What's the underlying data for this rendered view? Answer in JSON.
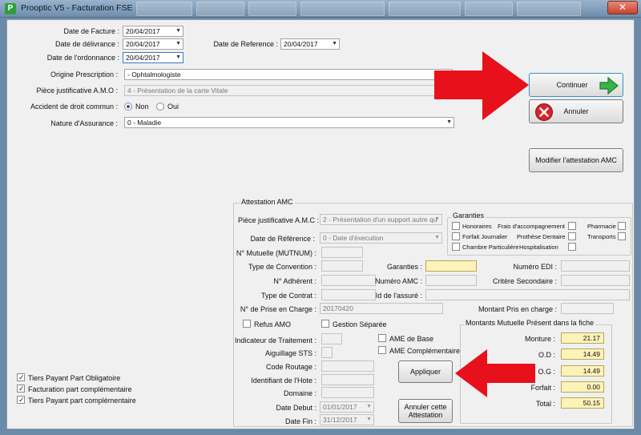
{
  "window": {
    "title": "Prooptic V5 - Facturation FSE",
    "app_icon": "P",
    "close_glyph": "✕"
  },
  "dates": {
    "facture_label": "Date de Facture :",
    "facture_value": "20/04/2017",
    "delivrance_label": "Date de délivrance :",
    "delivrance_value": "20/04/2017",
    "ordonnance_label": "Date de l'ordonnance :",
    "ordonnance_value": "20/04/2017",
    "reference_label": "Date de Reference :",
    "reference_value": "20/04/2017"
  },
  "prescription": {
    "origine_label": "Origine Prescription :",
    "origine_value": "- Ophtalmologiste",
    "piece_amo_label": "Pièce justificative A.M.O :",
    "piece_amo_value": "4 - Présentation de la carte Vitale",
    "accident_label": "Accident de droit commun :",
    "accident_no": "Non",
    "accident_yes": "Oui",
    "nature_label": "Nature d'Assurance :",
    "nature_value": "0 - Maladie"
  },
  "actions": {
    "continuer": "Continuer",
    "annuler": "Annuler",
    "modifier_amc": "Modifier l'attestation AMC",
    "appliquer": "Appliquer",
    "annuler_attestation": "Annuler cette Attestation"
  },
  "amc": {
    "group_title": "Attestation AMC",
    "piece_label": "Pièce justificative A.M.C :",
    "piece_value": "2 - Présentation d'un support autre qu",
    "date_ref_label": "Date de Référence :",
    "date_ref_value": "0 - Date d'éxecution",
    "mutnum_label": "N° Mutuelle (MUTNUM) :",
    "convention_label": "Type de Convention :",
    "garanties_label": "Garanties :",
    "numero_edi_label": "Numéro EDI :",
    "adherent_label": "N° Adhérent :",
    "numero_amc_label": "Numéro AMC :",
    "critere_label": "Critère Secondaire :",
    "contrat_label": "Type de Contrat :",
    "id_assure_label": "Id de l'assuré :",
    "prise_charge_label": "N° de Prise en Charge :",
    "prise_charge_value": "20170420",
    "montant_pris_label": "Montant Pris en charge :",
    "refus_amo": "Refus AMO",
    "gestion_separee": "Gestion Séparée",
    "indicateur_label": "Indicateur de Traitement :",
    "aiguillage_label": "Aiguillage STS :",
    "code_routage_label": "Code Routage :",
    "identifiant_hote_label": "Identifiant de l'Hote :",
    "domaine_label": "Domaine :",
    "ame_base": "AME de Base",
    "ame_complementaire": "AME Complémentaire",
    "date_debut_label": "Date Debut :",
    "date_debut_value": "01/01/2017",
    "date_fin_label": "Date Fin :",
    "date_fin_value": "31/12/2017"
  },
  "garanties": {
    "title": "Garanties",
    "honoraires": "Honoraires",
    "frais_accompagnement": "Frais d'accompagnement",
    "pharmacie": "Pharmacie",
    "forfait_journalier": "Forfait Journalier",
    "prothese_dentaire": "Prothèse Dentaire",
    "transports": "Transports",
    "chambre_particuliere": "Chambre Particulière",
    "hospitalisation": "Hospitalisation"
  },
  "montants": {
    "title": "Montants Mutuelle Présent dans la fiche",
    "monture_label": "Monture :",
    "monture_value": "21.17",
    "od_label": "O.D :",
    "od_value": "14.49",
    "og_label": "O.G :",
    "og_value": "14.49",
    "forfait_label": "Forfait :",
    "forfait_value": "0.00",
    "total_label": "Total :",
    "total_value": "50.15"
  },
  "tiers_payant": {
    "obligatoire": "Tiers Payant Part Obligatoire",
    "facturation_complementaire": "Facturation part complémentaire",
    "complementaire": "Tiers Payant part complémentaire"
  },
  "colors": {
    "arrow": "#e8101a",
    "green": "#37b34a",
    "cancel_red": "#d8232a",
    "highlight": "#fdf3b8"
  }
}
